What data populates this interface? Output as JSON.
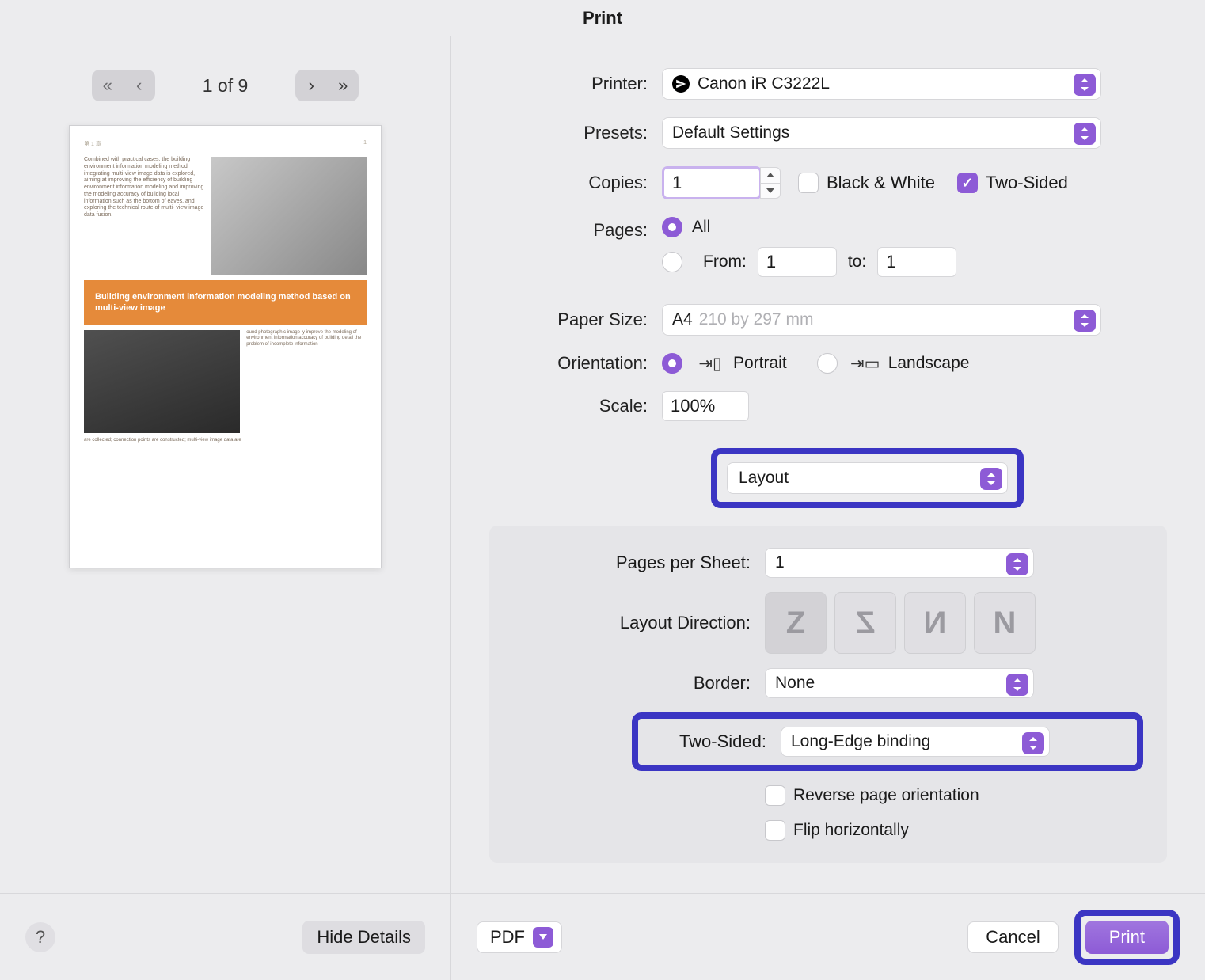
{
  "title": "Print",
  "preview": {
    "page_counter": "1 of 9",
    "doc": {
      "hdr_left": "第 1 章",
      "hdr_right": "1",
      "intro": "Combined with practical cases, the building environment information modeling method integrating multi-view image data is explored, aiming at improving the efficiency of building environment information modeling and improving the modeling accuracy of building local information such as the bottom of eaves, and exploring the technical route of multi- view image data fusion.",
      "banner": "Building environment information modeling method based on multi-view image",
      "text2": "ound photographic image ly improve the modeling of environment information accuracy of building detail the problem of incomplete information",
      "caption": "are collected; connection points are constructed; multi-view image data are"
    }
  },
  "printer": {
    "label": "Printer:",
    "value": "Canon iR C3222L"
  },
  "presets": {
    "label": "Presets:",
    "value": "Default Settings"
  },
  "copies": {
    "label": "Copies:",
    "value": "1",
    "bw": "Black & White",
    "twosided": "Two-Sided"
  },
  "pages": {
    "label": "Pages:",
    "all": "All",
    "from": "From:",
    "from_val": "1",
    "to": "to:",
    "to_val": "1"
  },
  "paper": {
    "label": "Paper Size:",
    "value": "A4",
    "hint": "210 by 297 mm"
  },
  "orientation": {
    "label": "Orientation:",
    "portrait": "Portrait",
    "landscape": "Landscape"
  },
  "scale": {
    "label": "Scale:",
    "value": "100%"
  },
  "section": {
    "value": "Layout"
  },
  "layout": {
    "pps_label": "Pages per Sheet:",
    "pps_value": "1",
    "dir_label": "Layout Direction:",
    "border_label": "Border:",
    "border_value": "None",
    "twosided_label": "Two-Sided:",
    "twosided_value": "Long-Edge binding",
    "reverse": "Reverse page orientation",
    "flip": "Flip horizontally"
  },
  "footer": {
    "help": "?",
    "hide": "Hide Details",
    "pdf": "PDF",
    "cancel": "Cancel",
    "print": "Print"
  }
}
